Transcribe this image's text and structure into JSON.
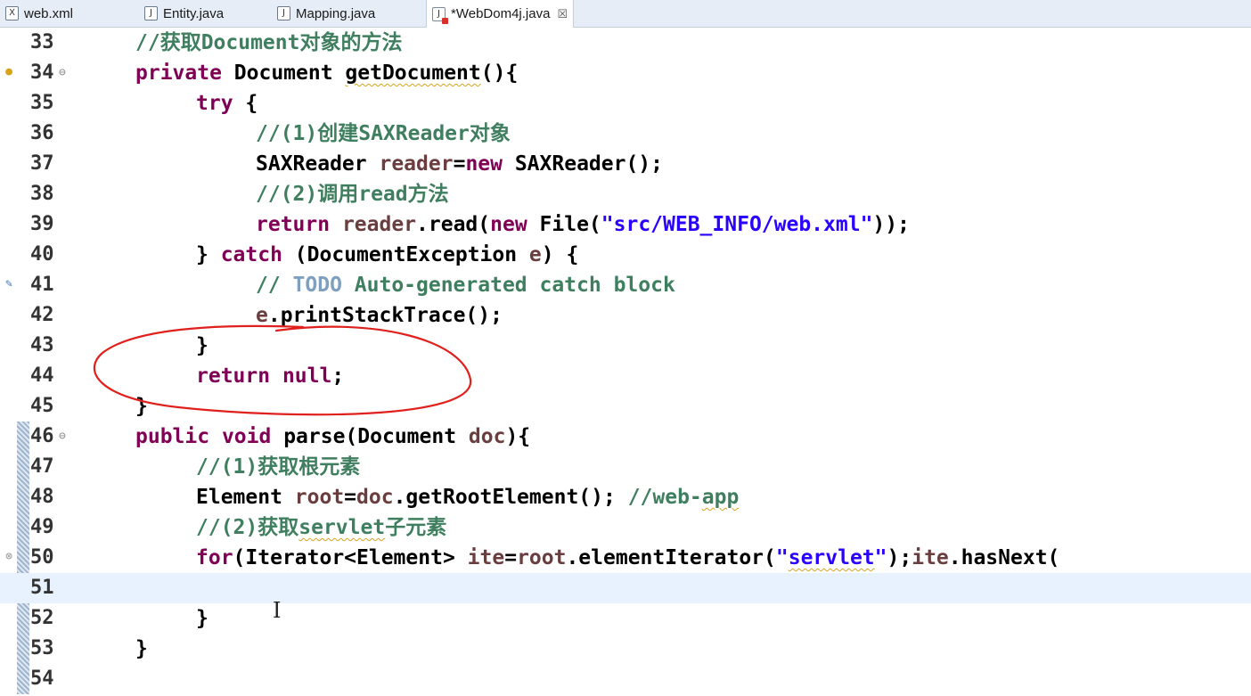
{
  "tabs": [
    {
      "icon": "xml-file-icon",
      "icon_glyph": "X",
      "label": "web.xml"
    },
    {
      "icon": "java-file-icon",
      "icon_glyph": "J",
      "label": "Entity.java"
    },
    {
      "icon": "java-file-icon",
      "icon_glyph": "J",
      "label": "Mapping.java"
    },
    {
      "icon": "java-file-error-icon",
      "icon_glyph": "J",
      "label": "*WebDom4j.java",
      "close": "☒"
    }
  ],
  "lines": [
    {
      "n": "33",
      "t": "//获取Document对象的方法"
    },
    {
      "n": "34",
      "t": "private Document getDocument(){"
    },
    {
      "n": "35",
      "t": "try {"
    },
    {
      "n": "36",
      "t": "//(1)创建SAXReader对象"
    },
    {
      "n": "37",
      "t": "SAXReader reader=new SAXReader();"
    },
    {
      "n": "38",
      "t": "//(2)调用read方法"
    },
    {
      "n": "39",
      "t": "return reader.read(new File(\"src/WEB_INFO/web.xml\"));"
    },
    {
      "n": "40",
      "t": "} catch (DocumentException e) {"
    },
    {
      "n": "41",
      "t": "// TODO Auto-generated catch block"
    },
    {
      "n": "42",
      "t": "e.printStackTrace();"
    },
    {
      "n": "43",
      "t": "}"
    },
    {
      "n": "44",
      "t": "return null;"
    },
    {
      "n": "45",
      "t": "}"
    },
    {
      "n": "46",
      "t": "public void parse(Document doc){"
    },
    {
      "n": "47",
      "t": "//(1)获取根元素"
    },
    {
      "n": "48",
      "t": "Element root=doc.getRootElement(); //web-app"
    },
    {
      "n": "49",
      "t": "//(2)获取servlet子元素"
    },
    {
      "n": "50",
      "t": "for(Iterator<Element> ite=root.elementIterator(\"servlet\");ite.hasNext("
    },
    {
      "n": "51",
      "t": ""
    },
    {
      "n": "52",
      "t": "}"
    },
    {
      "n": "53",
      "t": "}"
    },
    {
      "n": "54",
      "t": ""
    }
  ],
  "colors": {
    "keyword": "#7f0055",
    "comment": "#3f7f5f",
    "string": "#2a00ff",
    "local_variable": "#6a3e3e",
    "todo_tag": "#7f9fbf",
    "current_line": "#e8f2fe",
    "annotation_ellipse": "#e0201c"
  },
  "markers": {
    "warning_line": "34",
    "task_line": "41",
    "error_line": "50"
  }
}
